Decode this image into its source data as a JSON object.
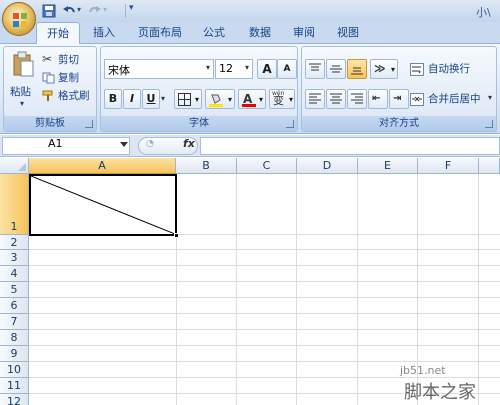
{
  "title_bar": {
    "title_fragment": "小\\"
  },
  "quick_access": {
    "icons": [
      "save-icon",
      "undo-icon",
      "redo-icon",
      "customize-icon"
    ]
  },
  "tabs": [
    {
      "label": "开始",
      "active": true
    },
    {
      "label": "插入"
    },
    {
      "label": "页面布局"
    },
    {
      "label": "公式"
    },
    {
      "label": "数据"
    },
    {
      "label": "审阅"
    },
    {
      "label": "视图"
    }
  ],
  "clipboard": {
    "paste_label": "粘贴",
    "cut_label": "剪切",
    "copy_label": "复制",
    "format_painter_label": "格式刷",
    "group_label": "剪贴板"
  },
  "font": {
    "family": "宋体",
    "size": "12",
    "grow_label": "A",
    "shrink_label": "A",
    "bold_label": "B",
    "italic_label": "I",
    "underline_label": "U",
    "font_color_label": "A",
    "phonetic_label": "wén",
    "phonetic_char": "变",
    "group_label": "字体"
  },
  "alignment": {
    "wrap_text_label": "自动换行",
    "merge_center_label": "合并后居中",
    "group_label": "对齐方式"
  },
  "formula_bar": {
    "name_box": "A1",
    "fx_label": "fx",
    "formula": ""
  },
  "grid": {
    "columns": [
      "A",
      "B",
      "C",
      "D",
      "E",
      "F"
    ],
    "rows": [
      "1",
      "2",
      "3",
      "4",
      "5",
      "6",
      "7",
      "8",
      "9",
      "10",
      "11",
      "12"
    ],
    "selected_cell": "A1"
  },
  "watermark": {
    "domain": "jb51.net",
    "site": "脚本之家"
  },
  "colors": {
    "accent": "#15428b",
    "selection": "#f6c25c",
    "ribbon": "#dde8f6"
  }
}
